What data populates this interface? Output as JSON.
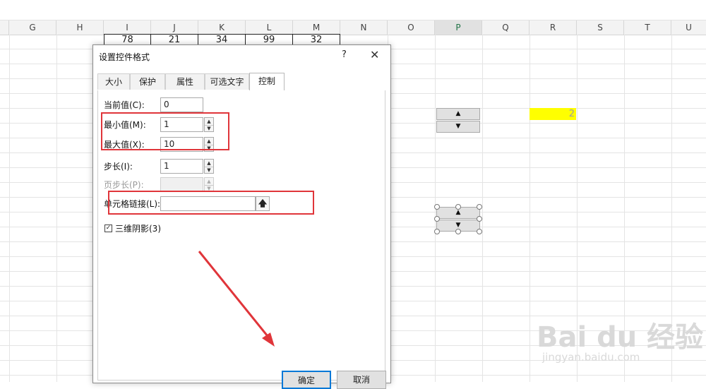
{
  "column_headers": [
    "G",
    "H",
    "I",
    "J",
    "K",
    "L",
    "M",
    "N",
    "O",
    "P",
    "Q",
    "R",
    "S",
    "T",
    "U"
  ],
  "top_row_values": [
    "78",
    "21",
    "34",
    "99",
    "32"
  ],
  "linked_cell_value": "2",
  "dialog": {
    "title": "设置控件格式",
    "help": "?",
    "close": "✕",
    "tabs": [
      "大小",
      "保护",
      "属性",
      "可选文字",
      "控制"
    ],
    "active_tab": "控制",
    "current_value": {
      "label": "当前值(C):",
      "value": "0"
    },
    "min_value": {
      "label": "最小值(M):",
      "value": "1"
    },
    "max_value": {
      "label": "最大值(X):",
      "value": "10"
    },
    "step": {
      "label": "步长(I):",
      "value": "1"
    },
    "page_step": {
      "label": "页步长(P):",
      "value": ""
    },
    "cell_link": {
      "label": "单元格链接(L):",
      "value": ""
    },
    "shading": {
      "label": "三维阴影(3)",
      "checked": true
    },
    "ok_label": "确定",
    "cancel_label": "取消"
  },
  "watermark": {
    "main": "Bai du 经验",
    "sub": "jingyan.baidu.com"
  },
  "colors": {
    "highlight": "#e0353a",
    "yellow": "#ffff00",
    "accent": "#217346"
  }
}
